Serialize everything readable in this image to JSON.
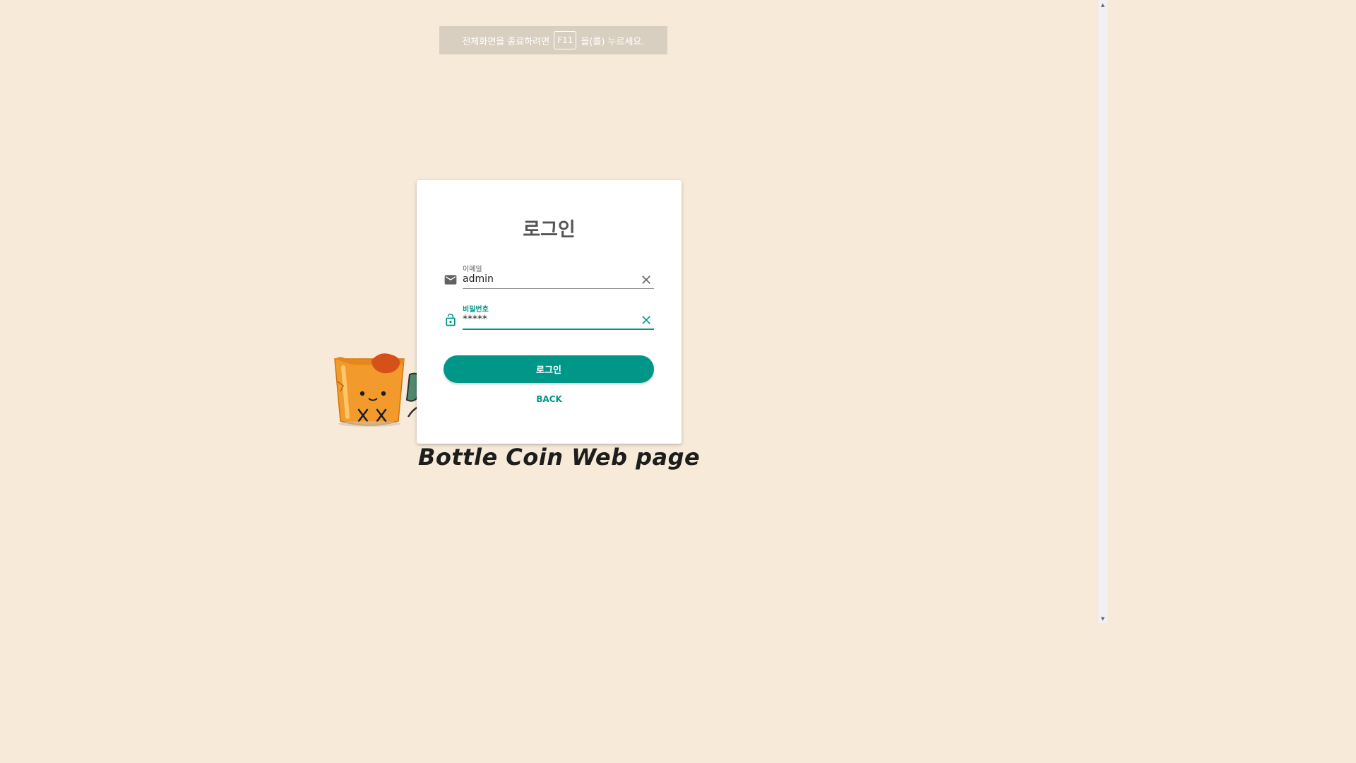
{
  "fullscreen_hint": {
    "before": "전체화면을 종료하려면",
    "key": "F11",
    "after": "을(를) 누르세요."
  },
  "branding": {
    "title": "Bottle Coin Web page"
  },
  "login": {
    "title": "로그인",
    "email": {
      "label": "이메일",
      "value": "admin",
      "icon": "mail-icon"
    },
    "password": {
      "label": "비밀번호",
      "value": "*****",
      "icon": "lock-icon"
    },
    "submit_label": "로그인",
    "back_label": "BACK"
  },
  "colors": {
    "background": "#f7ead8",
    "accent": "#009688",
    "banner": "#d9cfc0"
  }
}
